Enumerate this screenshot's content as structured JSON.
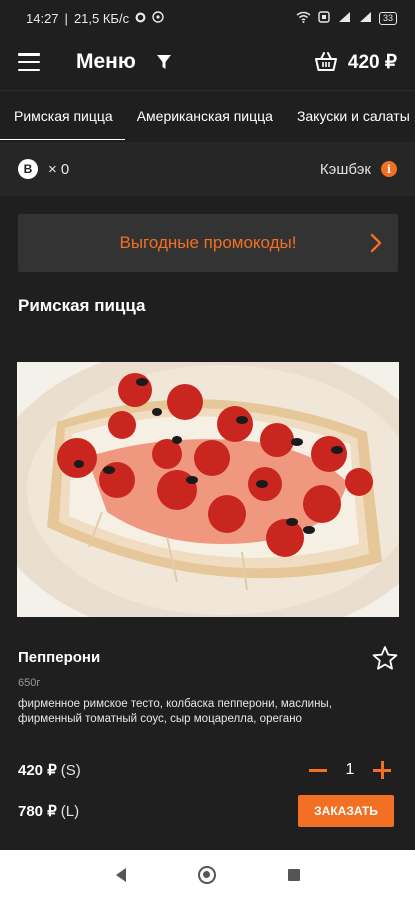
{
  "status_bar": {
    "time": "14:27",
    "speed": "21,5 КБ/с",
    "battery": "33"
  },
  "header": {
    "title": "Меню",
    "cart_total": "420 ₽"
  },
  "tabs": [
    "Римская пицца",
    "Американская пицца",
    "Закуски и салаты"
  ],
  "bonus": {
    "badge": "B",
    "count": "× 0",
    "cashback_label": "Кэшбэк",
    "info": "i"
  },
  "promo": {
    "label": "Выгодные промокоды!"
  },
  "section": {
    "title": "Римская пицца"
  },
  "product": {
    "name": "Пепперони",
    "weight": "650г",
    "description": "фирменное римское тесто, колбаска пепперони, маслины, фирменный томатный соус, сыр моцарелла, орегано",
    "price_s": "420 ₽",
    "size_s": "(S)",
    "price_l": "780 ₽",
    "size_l": "(L)",
    "quantity": "1",
    "order_label": "ЗАКАЗАТЬ"
  },
  "colors": {
    "accent": "#f26f23",
    "background": "#1f1f1f",
    "card": "#333333"
  }
}
